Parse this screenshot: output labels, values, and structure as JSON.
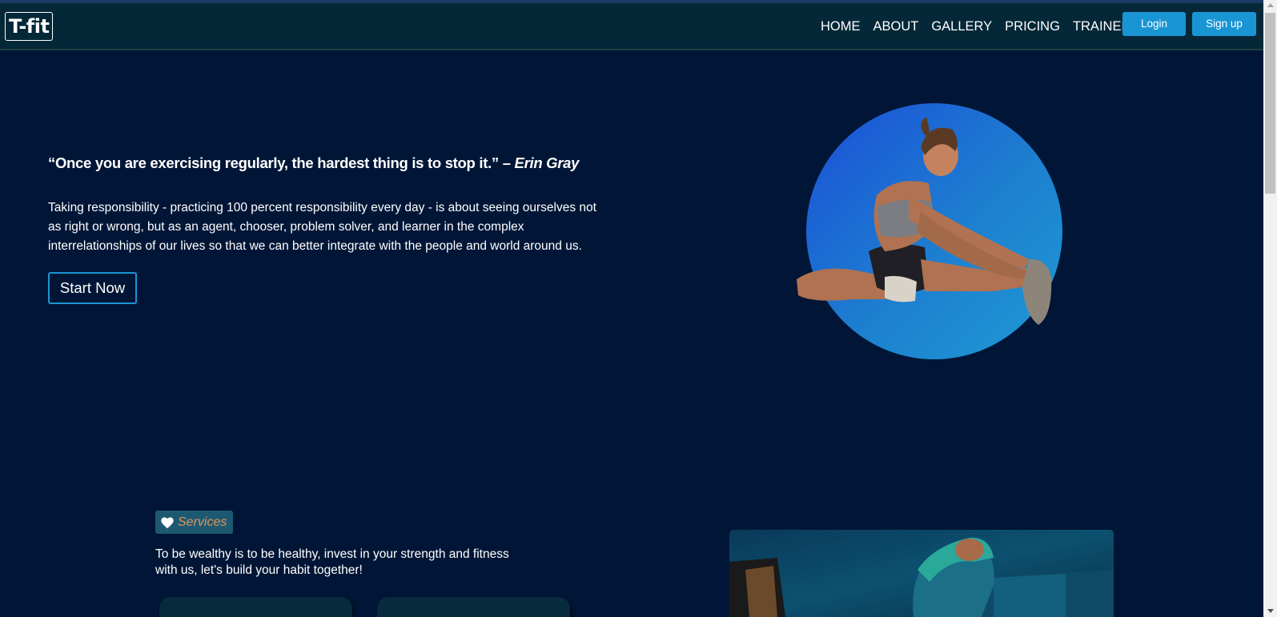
{
  "navbar": {
    "logo": "T-fit",
    "links": [
      "HOME",
      "ABOUT",
      "GALLERY",
      "PRICING",
      "TRAINERS"
    ],
    "login_label": "Login",
    "signup_label": "Sign up"
  },
  "hero": {
    "quote": "“Once you are exercising regularly, the hardest thing is to stop it.”",
    "quote_dash": " – ",
    "quote_author": "Erin Gray",
    "description": "Taking responsibility - practicing 100 percent responsibility every day - is about seeing ourselves not as right or wrong, but as an agent, chooser, problem solver, and learner in the complex interrelationships of our lives so that we can better integrate with the people and world around us.",
    "cta_label": "Start Now"
  },
  "services": {
    "badge_icon": "heart-icon",
    "badge_label": "Services",
    "text": "To be wealthy is to be healthy, invest in your strength and fitness with us, let's build your habit together!"
  },
  "colors": {
    "background": "#011636",
    "navbar": "#042838",
    "accent": "#1a95d4",
    "badge": "#1d5a72",
    "badge_text": "#e0935a"
  }
}
